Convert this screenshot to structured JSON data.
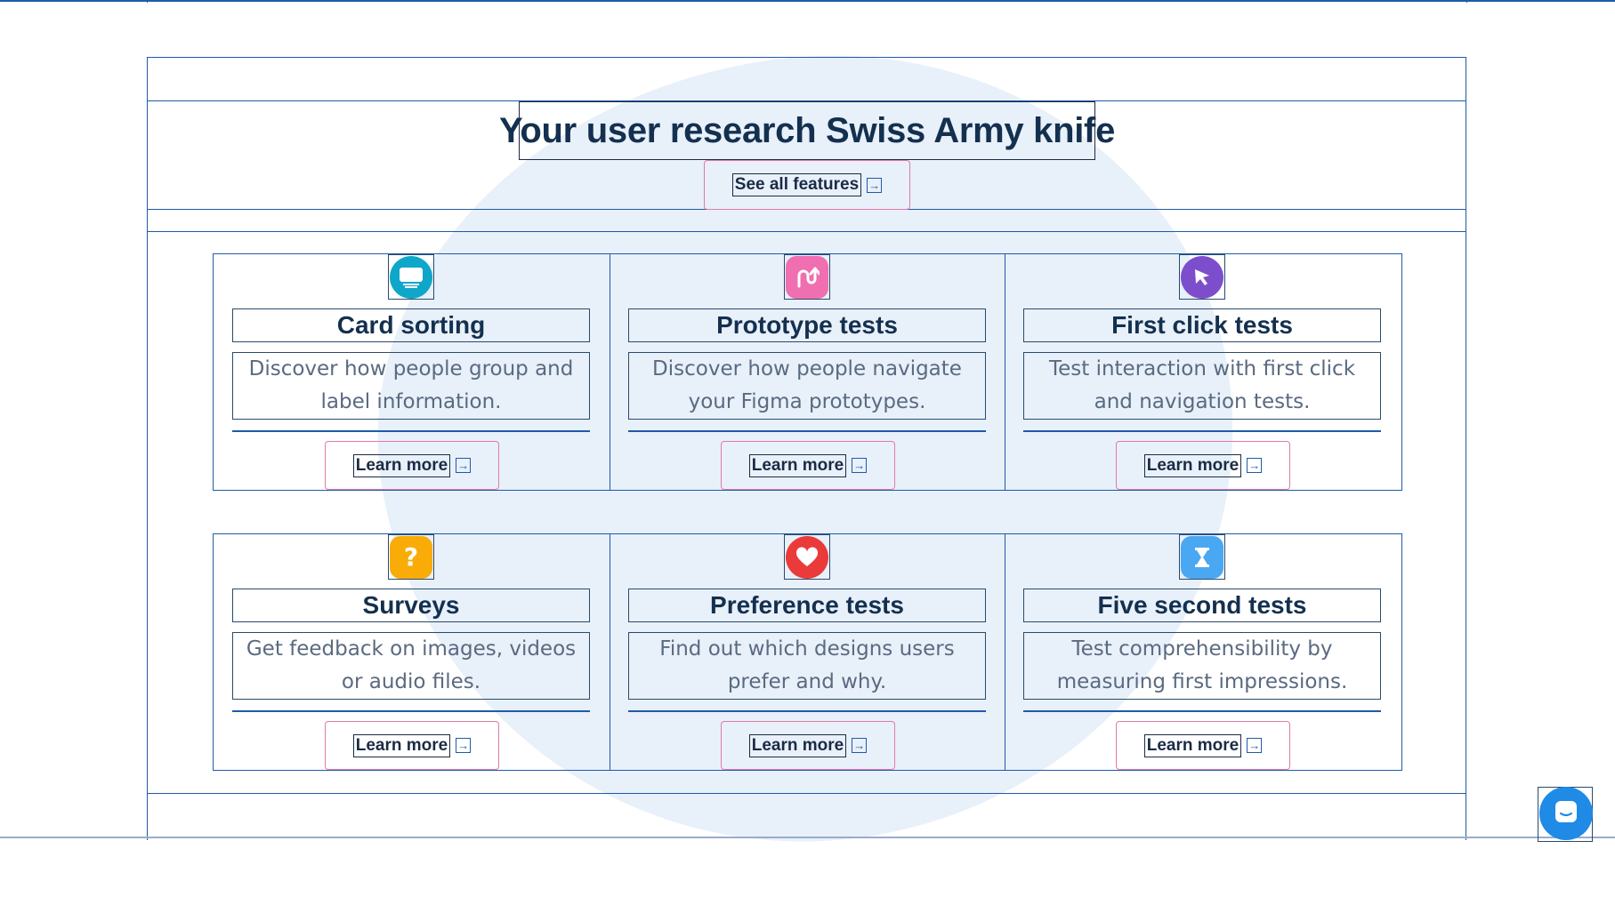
{
  "hero": {
    "title": "Your user research Swiss Army knife",
    "cta_label": "See all features",
    "cta_icon": "arrow-right-icon"
  },
  "features": [
    {
      "title": "Card sorting",
      "description": "Discover how people group and label information.",
      "link_label": "Learn more",
      "icon": "card-sorting-icon",
      "color": "#0fa7c9"
    },
    {
      "title": "Prototype tests",
      "description": "Discover how people navigate your Figma prototypes.",
      "link_label": "Learn more",
      "icon": "prototype-icon",
      "color": "#ef6fb0"
    },
    {
      "title": "First click tests",
      "description": "Test interaction with first click and navigation tests.",
      "link_label": "Learn more",
      "icon": "cursor-icon",
      "color": "#7d4ecb"
    },
    {
      "title": "Surveys",
      "description": "Get feedback on images, videos or audio files.",
      "link_label": "Learn more",
      "icon": "question-icon",
      "color": "#f9ac08"
    },
    {
      "title": "Preference tests",
      "description": "Find out which designs users prefer and why.",
      "link_label": "Learn more",
      "icon": "heart-icon",
      "color": "#ea3a3a"
    },
    {
      "title": "Five second tests",
      "description": "Test comprehensibility by measuring first impressions.",
      "link_label": "Learn more",
      "icon": "hourglass-icon",
      "color": "#4aa8f2"
    }
  ],
  "chat": {
    "icon": "chat-icon",
    "color": "#1f8be6"
  },
  "colors": {
    "accent": "#1f5aa8",
    "button_border": "#e07aa8",
    "heading": "#14304f",
    "body_text": "#5a6a80",
    "blob": "#e8f0fa"
  }
}
